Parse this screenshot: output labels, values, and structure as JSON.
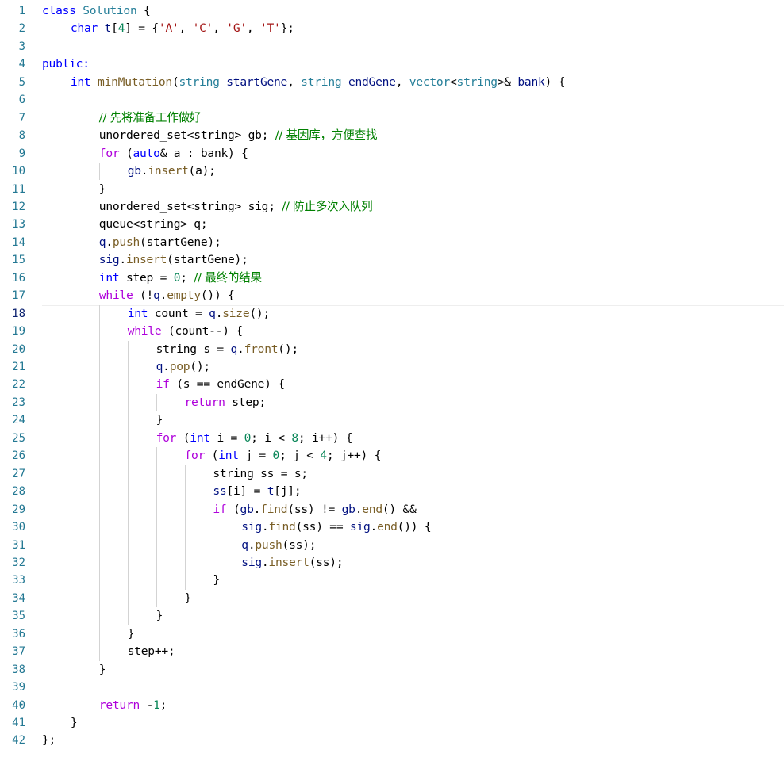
{
  "theme": {
    "background": "#ffffff",
    "line_number": "#237893",
    "line_number_active": "#0b216f",
    "indent_guide": "#d3d3d3",
    "colors": {
      "plain": "#000000",
      "kw": "#0000ff",
      "type": "#267f99",
      "fn": "#795e26",
      "str": "#a31515",
      "num": "#098658",
      "cmt": "#008000",
      "ctl": "#af00db",
      "var": "#001080"
    }
  },
  "editor": {
    "active_line": 18,
    "lines": [
      {
        "n": "1",
        "indent": 0,
        "tokens": [
          [
            "class ",
            "kw"
          ],
          [
            "Solution",
            "type"
          ],
          [
            " {",
            "plain"
          ]
        ]
      },
      {
        "n": "2",
        "indent": 1,
        "tokens": [
          [
            "char ",
            "kw"
          ],
          [
            "t",
            "var"
          ],
          [
            "[",
            "plain"
          ],
          [
            "4",
            "num"
          ],
          [
            "] = {",
            "plain"
          ],
          [
            "'A'",
            "str"
          ],
          [
            ", ",
            "plain"
          ],
          [
            "'C'",
            "str"
          ],
          [
            ", ",
            "plain"
          ],
          [
            "'G'",
            "str"
          ],
          [
            ", ",
            "plain"
          ],
          [
            "'T'",
            "str"
          ],
          [
            "};",
            "plain"
          ]
        ]
      },
      {
        "n": "3",
        "indent": 0,
        "tokens": []
      },
      {
        "n": "4",
        "indent": 0,
        "tokens": [
          [
            "public:",
            "kw"
          ]
        ]
      },
      {
        "n": "5",
        "indent": 1,
        "tokens": [
          [
            "int ",
            "kw"
          ],
          [
            "minMutation",
            "fn"
          ],
          [
            "(",
            "plain"
          ],
          [
            "string ",
            "type"
          ],
          [
            "startGene",
            "var"
          ],
          [
            ", ",
            "plain"
          ],
          [
            "string ",
            "type"
          ],
          [
            "endGene",
            "var"
          ],
          [
            ", ",
            "plain"
          ],
          [
            "vector",
            "type"
          ],
          [
            "<",
            "plain"
          ],
          [
            "string",
            "type"
          ],
          [
            ">& ",
            "plain"
          ],
          [
            "bank",
            "var"
          ],
          [
            ") {",
            "plain"
          ]
        ]
      },
      {
        "n": "6",
        "indent": 0,
        "tokens": []
      },
      {
        "n": "7",
        "indent": 2,
        "tokens": [
          [
            "// 先将准备工作做好",
            "cmt"
          ]
        ]
      },
      {
        "n": "8",
        "indent": 2,
        "tokens": [
          [
            "unordered_set<string> gb; ",
            "plain"
          ],
          [
            "// 基因库，方便查找",
            "cmt"
          ]
        ]
      },
      {
        "n": "9",
        "indent": 2,
        "tokens": [
          [
            "for ",
            "ctl"
          ],
          [
            "(",
            "plain"
          ],
          [
            "auto",
            "kw"
          ],
          [
            "& a : bank) {",
            "plain"
          ]
        ]
      },
      {
        "n": "10",
        "indent": 3,
        "tokens": [
          [
            "gb",
            "var"
          ],
          [
            ".",
            "plain"
          ],
          [
            "insert",
            "fn"
          ],
          [
            "(a);",
            "plain"
          ]
        ]
      },
      {
        "n": "11",
        "indent": 2,
        "tokens": [
          [
            "}",
            "plain"
          ]
        ]
      },
      {
        "n": "12",
        "indent": 2,
        "tokens": [
          [
            "unordered_set<string> sig; ",
            "plain"
          ],
          [
            "// 防止多次入队列",
            "cmt"
          ]
        ]
      },
      {
        "n": "13",
        "indent": 2,
        "tokens": [
          [
            "queue<string> q;",
            "plain"
          ]
        ]
      },
      {
        "n": "14",
        "indent": 2,
        "tokens": [
          [
            "q",
            "var"
          ],
          [
            ".",
            "plain"
          ],
          [
            "push",
            "fn"
          ],
          [
            "(startGene);",
            "plain"
          ]
        ]
      },
      {
        "n": "15",
        "indent": 2,
        "tokens": [
          [
            "sig",
            "var"
          ],
          [
            ".",
            "plain"
          ],
          [
            "insert",
            "fn"
          ],
          [
            "(startGene);",
            "plain"
          ]
        ]
      },
      {
        "n": "16",
        "indent": 2,
        "tokens": [
          [
            "int ",
            "kw"
          ],
          [
            "step = ",
            "plain"
          ],
          [
            "0",
            "num"
          ],
          [
            "; ",
            "plain"
          ],
          [
            "// 最终的结果",
            "cmt"
          ]
        ]
      },
      {
        "n": "17",
        "indent": 2,
        "tokens": [
          [
            "while ",
            "ctl"
          ],
          [
            "(!",
            "plain"
          ],
          [
            "q",
            "var"
          ],
          [
            ".",
            "plain"
          ],
          [
            "empty",
            "fn"
          ],
          [
            "()) {",
            "plain"
          ]
        ]
      },
      {
        "n": "18",
        "indent": 3,
        "tokens": [
          [
            "int ",
            "kw"
          ],
          [
            "count = ",
            "plain"
          ],
          [
            "q",
            "var"
          ],
          [
            ".",
            "plain"
          ],
          [
            "size",
            "fn"
          ],
          [
            "();",
            "plain"
          ]
        ]
      },
      {
        "n": "19",
        "indent": 3,
        "tokens": [
          [
            "while ",
            "ctl"
          ],
          [
            "(count--) {",
            "plain"
          ]
        ]
      },
      {
        "n": "20",
        "indent": 4,
        "tokens": [
          [
            "string s = ",
            "plain"
          ],
          [
            "q",
            "var"
          ],
          [
            ".",
            "plain"
          ],
          [
            "front",
            "fn"
          ],
          [
            "();",
            "plain"
          ]
        ]
      },
      {
        "n": "21",
        "indent": 4,
        "tokens": [
          [
            "q",
            "var"
          ],
          [
            ".",
            "plain"
          ],
          [
            "pop",
            "fn"
          ],
          [
            "();",
            "plain"
          ]
        ]
      },
      {
        "n": "22",
        "indent": 4,
        "tokens": [
          [
            "if ",
            "ctl"
          ],
          [
            "(s == endGene) {",
            "plain"
          ]
        ]
      },
      {
        "n": "23",
        "indent": 5,
        "tokens": [
          [
            "return ",
            "ctl"
          ],
          [
            "step;",
            "plain"
          ]
        ]
      },
      {
        "n": "24",
        "indent": 4,
        "tokens": [
          [
            "}",
            "plain"
          ]
        ]
      },
      {
        "n": "25",
        "indent": 4,
        "tokens": [
          [
            "for ",
            "ctl"
          ],
          [
            "(",
            "plain"
          ],
          [
            "int ",
            "kw"
          ],
          [
            "i = ",
            "plain"
          ],
          [
            "0",
            "num"
          ],
          [
            "; i < ",
            "plain"
          ],
          [
            "8",
            "num"
          ],
          [
            "; i++) {",
            "plain"
          ]
        ]
      },
      {
        "n": "26",
        "indent": 5,
        "tokens": [
          [
            "for ",
            "ctl"
          ],
          [
            "(",
            "plain"
          ],
          [
            "int ",
            "kw"
          ],
          [
            "j = ",
            "plain"
          ],
          [
            "0",
            "num"
          ],
          [
            "; j < ",
            "plain"
          ],
          [
            "4",
            "num"
          ],
          [
            "; j++) {",
            "plain"
          ]
        ]
      },
      {
        "n": "27",
        "indent": 6,
        "tokens": [
          [
            "string ss = s;",
            "plain"
          ]
        ]
      },
      {
        "n": "28",
        "indent": 6,
        "tokens": [
          [
            "ss",
            "var"
          ],
          [
            "[i] = ",
            "plain"
          ],
          [
            "t",
            "var"
          ],
          [
            "[j];",
            "plain"
          ]
        ]
      },
      {
        "n": "29",
        "indent": 6,
        "tokens": [
          [
            "if ",
            "ctl"
          ],
          [
            "(",
            "plain"
          ],
          [
            "gb",
            "var"
          ],
          [
            ".",
            "plain"
          ],
          [
            "find",
            "fn"
          ],
          [
            "(ss) != ",
            "plain"
          ],
          [
            "gb",
            "var"
          ],
          [
            ".",
            "plain"
          ],
          [
            "end",
            "fn"
          ],
          [
            "() &&",
            "plain"
          ]
        ]
      },
      {
        "n": "30",
        "indent": 7,
        "tokens": [
          [
            "sig",
            "var"
          ],
          [
            ".",
            "plain"
          ],
          [
            "find",
            "fn"
          ],
          [
            "(ss) == ",
            "plain"
          ],
          [
            "sig",
            "var"
          ],
          [
            ".",
            "plain"
          ],
          [
            "end",
            "fn"
          ],
          [
            "()) {",
            "plain"
          ]
        ]
      },
      {
        "n": "31",
        "indent": 7,
        "tokens": [
          [
            "q",
            "var"
          ],
          [
            ".",
            "plain"
          ],
          [
            "push",
            "fn"
          ],
          [
            "(ss);",
            "plain"
          ]
        ]
      },
      {
        "n": "32",
        "indent": 7,
        "tokens": [
          [
            "sig",
            "var"
          ],
          [
            ".",
            "plain"
          ],
          [
            "insert",
            "fn"
          ],
          [
            "(ss);",
            "plain"
          ]
        ]
      },
      {
        "n": "33",
        "indent": 6,
        "tokens": [
          [
            "}",
            "plain"
          ]
        ]
      },
      {
        "n": "34",
        "indent": 5,
        "tokens": [
          [
            "}",
            "plain"
          ]
        ]
      },
      {
        "n": "35",
        "indent": 4,
        "tokens": [
          [
            "}",
            "plain"
          ]
        ]
      },
      {
        "n": "36",
        "indent": 3,
        "tokens": [
          [
            "}",
            "plain"
          ]
        ]
      },
      {
        "n": "37",
        "indent": 3,
        "tokens": [
          [
            "step++;",
            "plain"
          ]
        ]
      },
      {
        "n": "38",
        "indent": 2,
        "tokens": [
          [
            "}",
            "plain"
          ]
        ]
      },
      {
        "n": "39",
        "indent": 0,
        "tokens": []
      },
      {
        "n": "40",
        "indent": 2,
        "tokens": [
          [
            "return ",
            "ctl"
          ],
          [
            "-",
            "plain"
          ],
          [
            "1",
            "num"
          ],
          [
            ";",
            "plain"
          ]
        ]
      },
      {
        "n": "41",
        "indent": 1,
        "tokens": [
          [
            "}",
            "plain"
          ]
        ]
      },
      {
        "n": "42",
        "indent": 0,
        "tokens": [
          [
            "};",
            "plain"
          ]
        ]
      }
    ],
    "guides": [
      {
        "col": 1,
        "from": 6,
        "to": 40
      },
      {
        "col": 2,
        "from": 10,
        "to": 10
      },
      {
        "col": 2,
        "from": 18,
        "to": 37
      },
      {
        "col": 3,
        "from": 20,
        "to": 35
      },
      {
        "col": 4,
        "from": 23,
        "to": 23
      },
      {
        "col": 4,
        "from": 26,
        "to": 34
      },
      {
        "col": 5,
        "from": 27,
        "to": 33
      },
      {
        "col": 6,
        "from": 30,
        "to": 32
      }
    ]
  }
}
